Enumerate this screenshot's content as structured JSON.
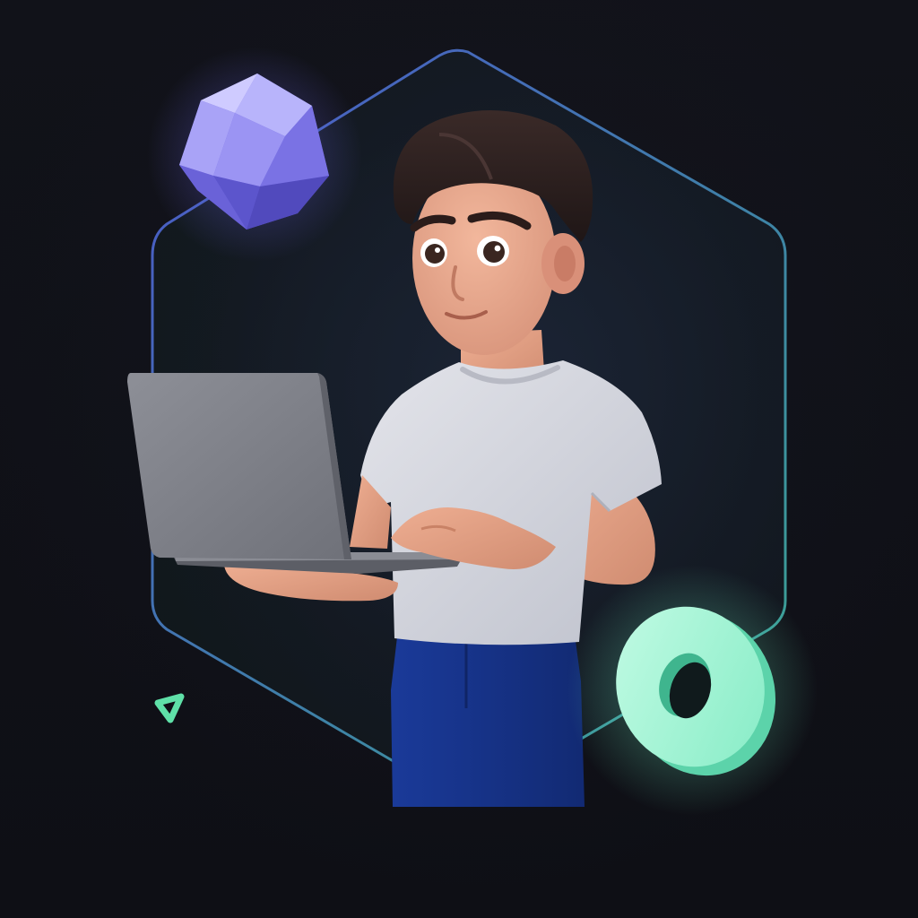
{
  "scene": {
    "subject": "3d-avatar-with-laptop",
    "palette": {
      "background": "#0f1016",
      "frame_start": "#4a58c8",
      "frame_end": "#3aa892",
      "gem": "#7d74ea",
      "ring": "#9ef5d2",
      "shirt": "#d4d6de",
      "jeans": "#17338a",
      "hair": "#2a1d1d",
      "skin": "#e8a98d",
      "laptop": "#7e8088"
    }
  }
}
